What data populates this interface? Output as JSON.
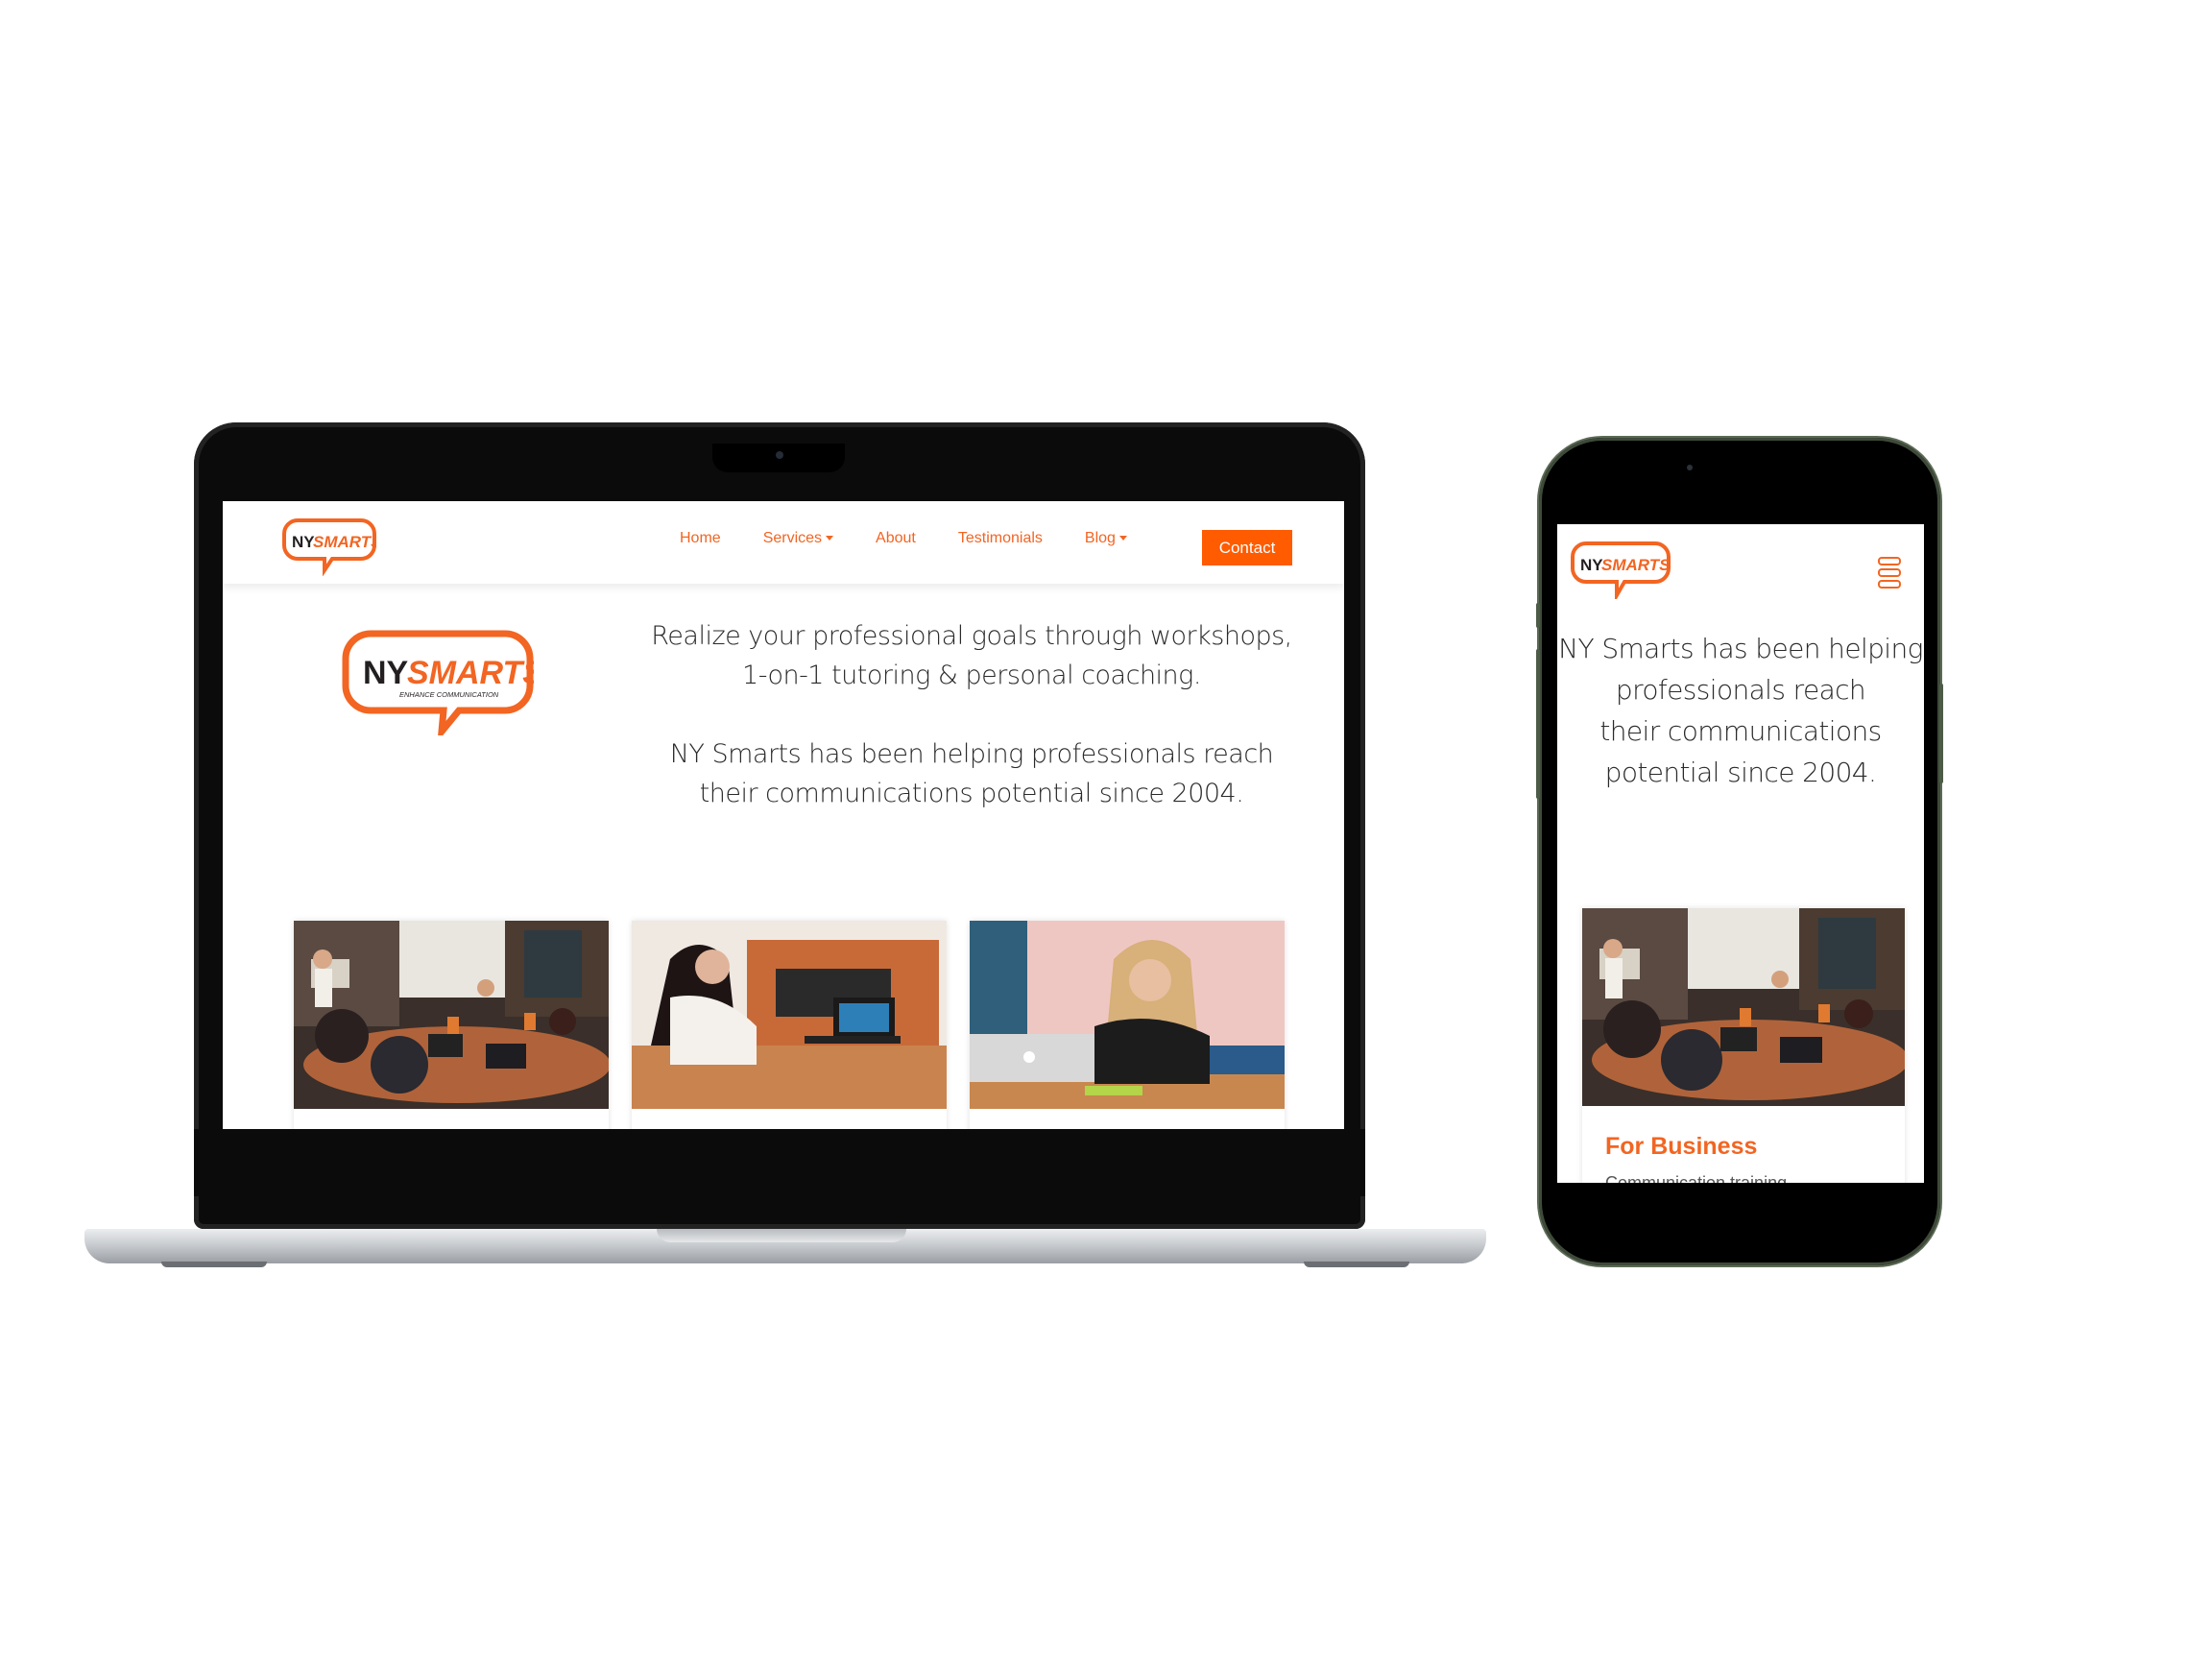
{
  "brand": {
    "logo_left": "NY",
    "logo_right": "SMARTS",
    "tagline": "ENHANCE COMMUNICATION",
    "accent_color": "#f26522",
    "cta_color": "#ff5b00",
    "dark_color": "#231f20"
  },
  "desktop": {
    "nav": {
      "items": [
        {
          "label": "Home",
          "dropdown": false
        },
        {
          "label": "Services",
          "dropdown": true
        },
        {
          "label": "About",
          "dropdown": false
        },
        {
          "label": "Testimonials",
          "dropdown": false
        },
        {
          "label": "Blog",
          "dropdown": true
        }
      ],
      "contact_label": "Contact"
    },
    "hero": {
      "line1": "Realize your professional goals through workshops,",
      "line2": "1-on-1 tutoring & personal coaching.",
      "line3": "NY Smarts has been helping professionals reach",
      "line4": "their communications potential since 2004."
    },
    "cards": [
      {
        "image": "meeting-room-group-photo"
      },
      {
        "image": "woman-laptop-office-photo"
      },
      {
        "image": "woman-thinking-laptop-photo"
      }
    ]
  },
  "mobile": {
    "menu_icon": "hamburger-menu-icon",
    "hero": {
      "line1": "NY Smarts has been helping",
      "line2": "professionals reach",
      "line3": "their communications",
      "line4": "potential since 2004."
    },
    "card": {
      "image": "meeting-room-group-photo",
      "title": "For Business",
      "subtitle": "Communication training"
    }
  }
}
